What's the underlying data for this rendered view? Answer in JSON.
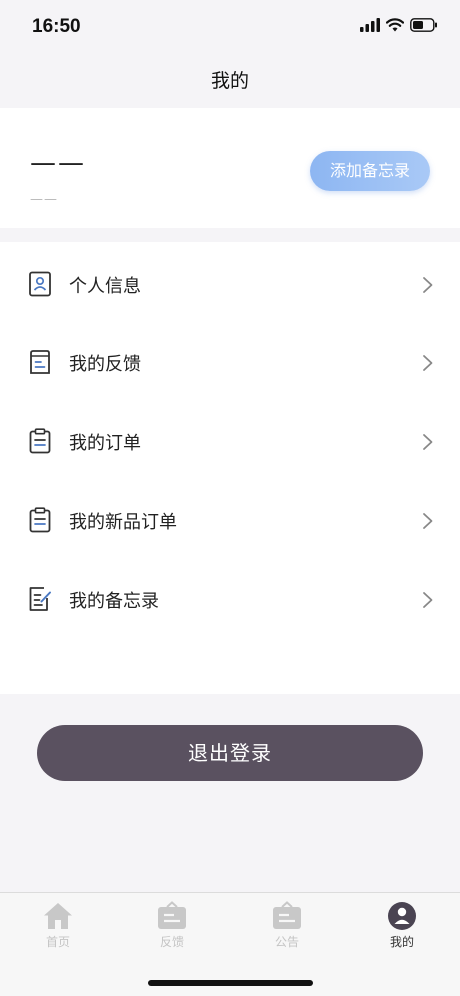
{
  "status_bar": {
    "time": "16:50"
  },
  "header": {
    "title": "我的"
  },
  "profile": {
    "name": "——",
    "subtitle": "——",
    "memo_button": "添加备忘录"
  },
  "menu": {
    "items": [
      {
        "label": "个人信息",
        "icon": "person-card-icon"
      },
      {
        "label": "我的反馈",
        "icon": "feedback-icon"
      },
      {
        "label": "我的订单",
        "icon": "clipboard-icon"
      },
      {
        "label": "我的新品订单",
        "icon": "clipboard-icon"
      },
      {
        "label": "我的备忘录",
        "icon": "memo-edit-icon"
      }
    ]
  },
  "logout_button": "退出登录",
  "tabbar": {
    "tabs": [
      {
        "label": "首页",
        "icon": "home-icon",
        "active": false
      },
      {
        "label": "反馈",
        "icon": "feedback-board-icon",
        "active": false
      },
      {
        "label": "公告",
        "icon": "notice-board-icon",
        "active": false
      },
      {
        "label": "我的",
        "icon": "user-circle-icon",
        "active": true
      }
    ]
  },
  "colors": {
    "accent_gradient_start": "#8db6f2",
    "accent_gradient_end": "#a9c9f6",
    "logout_button": "#5a5160",
    "background": "#f5f4f7"
  }
}
